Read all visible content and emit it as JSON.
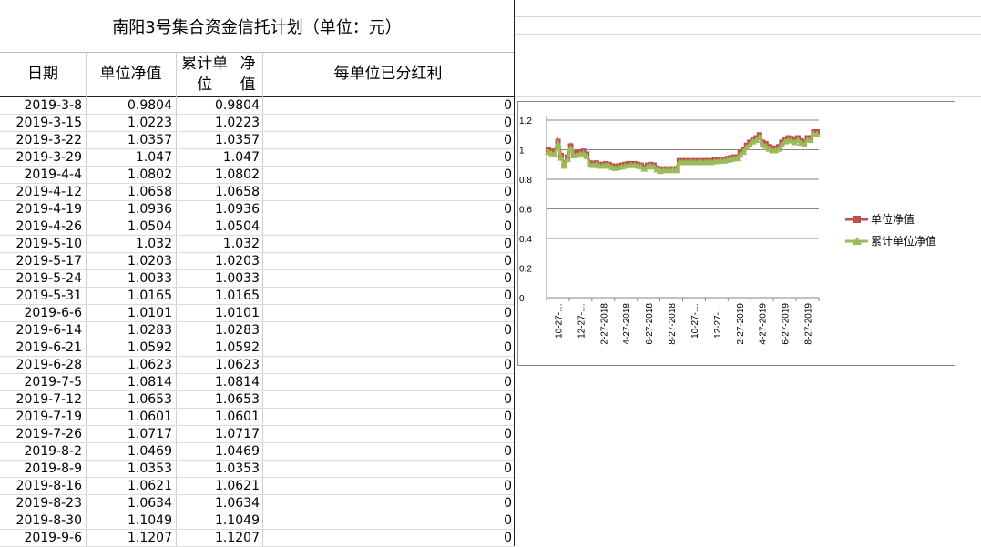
{
  "title": "南阳3号集合资金信托计划（单位：元）",
  "headers": {
    "date": "日期",
    "unit_nav": "单位净值",
    "cum_nav_line1": "累计单位",
    "cum_nav_line2": "净值",
    "dividend": "每单位已分红利"
  },
  "rows": [
    {
      "date": "2019-3-8",
      "unit": "0.9804",
      "cum": "0.9804",
      "div": "0"
    },
    {
      "date": "2019-3-15",
      "unit": "1.0223",
      "cum": "1.0223",
      "div": "0"
    },
    {
      "date": "2019-3-22",
      "unit": "1.0357",
      "cum": "1.0357",
      "div": "0"
    },
    {
      "date": "2019-3-29",
      "unit": "1.047",
      "cum": "1.047",
      "div": "0"
    },
    {
      "date": "2019-4-4",
      "unit": "1.0802",
      "cum": "1.0802",
      "div": "0"
    },
    {
      "date": "2019-4-12",
      "unit": "1.0658",
      "cum": "1.0658",
      "div": "0"
    },
    {
      "date": "2019-4-19",
      "unit": "1.0936",
      "cum": "1.0936",
      "div": "0"
    },
    {
      "date": "2019-4-26",
      "unit": "1.0504",
      "cum": "1.0504",
      "div": "0"
    },
    {
      "date": "2019-5-10",
      "unit": "1.032",
      "cum": "1.032",
      "div": "0"
    },
    {
      "date": "2019-5-17",
      "unit": "1.0203",
      "cum": "1.0203",
      "div": "0"
    },
    {
      "date": "2019-5-24",
      "unit": "1.0033",
      "cum": "1.0033",
      "div": "0"
    },
    {
      "date": "2019-5-31",
      "unit": "1.0165",
      "cum": "1.0165",
      "div": "0"
    },
    {
      "date": "2019-6-6",
      "unit": "1.0101",
      "cum": "1.0101",
      "div": "0"
    },
    {
      "date": "2019-6-14",
      "unit": "1.0283",
      "cum": "1.0283",
      "div": "0"
    },
    {
      "date": "2019-6-21",
      "unit": "1.0592",
      "cum": "1.0592",
      "div": "0"
    },
    {
      "date": "2019-6-28",
      "unit": "1.0623",
      "cum": "1.0623",
      "div": "0"
    },
    {
      "date": "2019-7-5",
      "unit": "1.0814",
      "cum": "1.0814",
      "div": "0"
    },
    {
      "date": "2019-7-12",
      "unit": "1.0653",
      "cum": "1.0653",
      "div": "0"
    },
    {
      "date": "2019-7-19",
      "unit": "1.0601",
      "cum": "1.0601",
      "div": "0"
    },
    {
      "date": "2019-7-26",
      "unit": "1.0717",
      "cum": "1.0717",
      "div": "0"
    },
    {
      "date": "2019-8-2",
      "unit": "1.0469",
      "cum": "1.0469",
      "div": "0"
    },
    {
      "date": "2019-8-9",
      "unit": "1.0353",
      "cum": "1.0353",
      "div": "0"
    },
    {
      "date": "2019-8-16",
      "unit": "1.0621",
      "cum": "1.0621",
      "div": "0"
    },
    {
      "date": "2019-8-23",
      "unit": "1.0634",
      "cum": "1.0634",
      "div": "0"
    },
    {
      "date": "2019-8-30",
      "unit": "1.1049",
      "cum": "1.1049",
      "div": "0"
    },
    {
      "date": "2019-9-6",
      "unit": "1.1207",
      "cum": "1.1207",
      "div": "0"
    }
  ],
  "chart_data": {
    "type": "line",
    "x_tick_labels": [
      "10-27-…",
      "12-27-…",
      "2-27-2018",
      "4-27-2018",
      "6-27-2018",
      "8-27-2018",
      "10-27-…",
      "12-27-…",
      "2-27-2019",
      "4-27-2019",
      "6-27-2019",
      "8-27-2019"
    ],
    "y_tick_labels": [
      "0",
      "0.2",
      "0.4",
      "0.6",
      "0.8",
      "1",
      "1.2"
    ],
    "ylim": [
      0,
      1.2
    ],
    "grid": true,
    "legend_position": "right",
    "series": [
      {
        "name": "单位净值",
        "color": "#c0504d",
        "marker": "square",
        "values": [
          1.0,
          0.99,
          0.985,
          1.055,
          0.96,
          0.9,
          0.95,
          1.025,
          0.975,
          0.98,
          0.985,
          0.99,
          0.97,
          0.91,
          0.905,
          0.91,
          0.9,
          0.9,
          0.905,
          0.9,
          0.89,
          0.885,
          0.89,
          0.895,
          0.9,
          0.905,
          0.905,
          0.905,
          0.9,
          0.895,
          0.88,
          0.895,
          0.9,
          0.895,
          0.875,
          0.865,
          0.87,
          0.87,
          0.87,
          0.87,
          0.87,
          0.925,
          0.925,
          0.925,
          0.925,
          0.925,
          0.925,
          0.925,
          0.925,
          0.925,
          0.925,
          0.925,
          0.93,
          0.93,
          0.935,
          0.935,
          0.94,
          0.945,
          0.95,
          0.95,
          0.98,
          1.0,
          1.03,
          1.05,
          1.07,
          1.08,
          1.1,
          1.05,
          1.04,
          1.02,
          1.01,
          1.01,
          1.02,
          1.05,
          1.07,
          1.08,
          1.075,
          1.065,
          1.08,
          1.06,
          1.05,
          1.08,
          1.08,
          1.12,
          1.12
        ]
      },
      {
        "name": "累计单位净值",
        "color": "#9bbb59",
        "marker": "triangle",
        "values": [
          0.985,
          0.975,
          0.97,
          1.04,
          0.945,
          0.89,
          0.935,
          1.01,
          0.96,
          0.965,
          0.97,
          0.975,
          0.955,
          0.9,
          0.895,
          0.9,
          0.89,
          0.89,
          0.895,
          0.89,
          0.88,
          0.875,
          0.88,
          0.885,
          0.89,
          0.895,
          0.895,
          0.895,
          0.89,
          0.885,
          0.87,
          0.885,
          0.89,
          0.885,
          0.865,
          0.855,
          0.86,
          0.86,
          0.86,
          0.86,
          0.86,
          0.915,
          0.915,
          0.915,
          0.915,
          0.915,
          0.915,
          0.915,
          0.915,
          0.915,
          0.915,
          0.915,
          0.92,
          0.92,
          0.925,
          0.925,
          0.93,
          0.935,
          0.94,
          0.94,
          0.965,
          0.985,
          1.015,
          1.035,
          1.055,
          1.065,
          1.085,
          1.035,
          1.025,
          1.005,
          0.995,
          0.995,
          1.005,
          1.035,
          1.055,
          1.065,
          1.06,
          1.05,
          1.065,
          1.045,
          1.035,
          1.065,
          1.065,
          1.105,
          1.105
        ]
      }
    ]
  }
}
